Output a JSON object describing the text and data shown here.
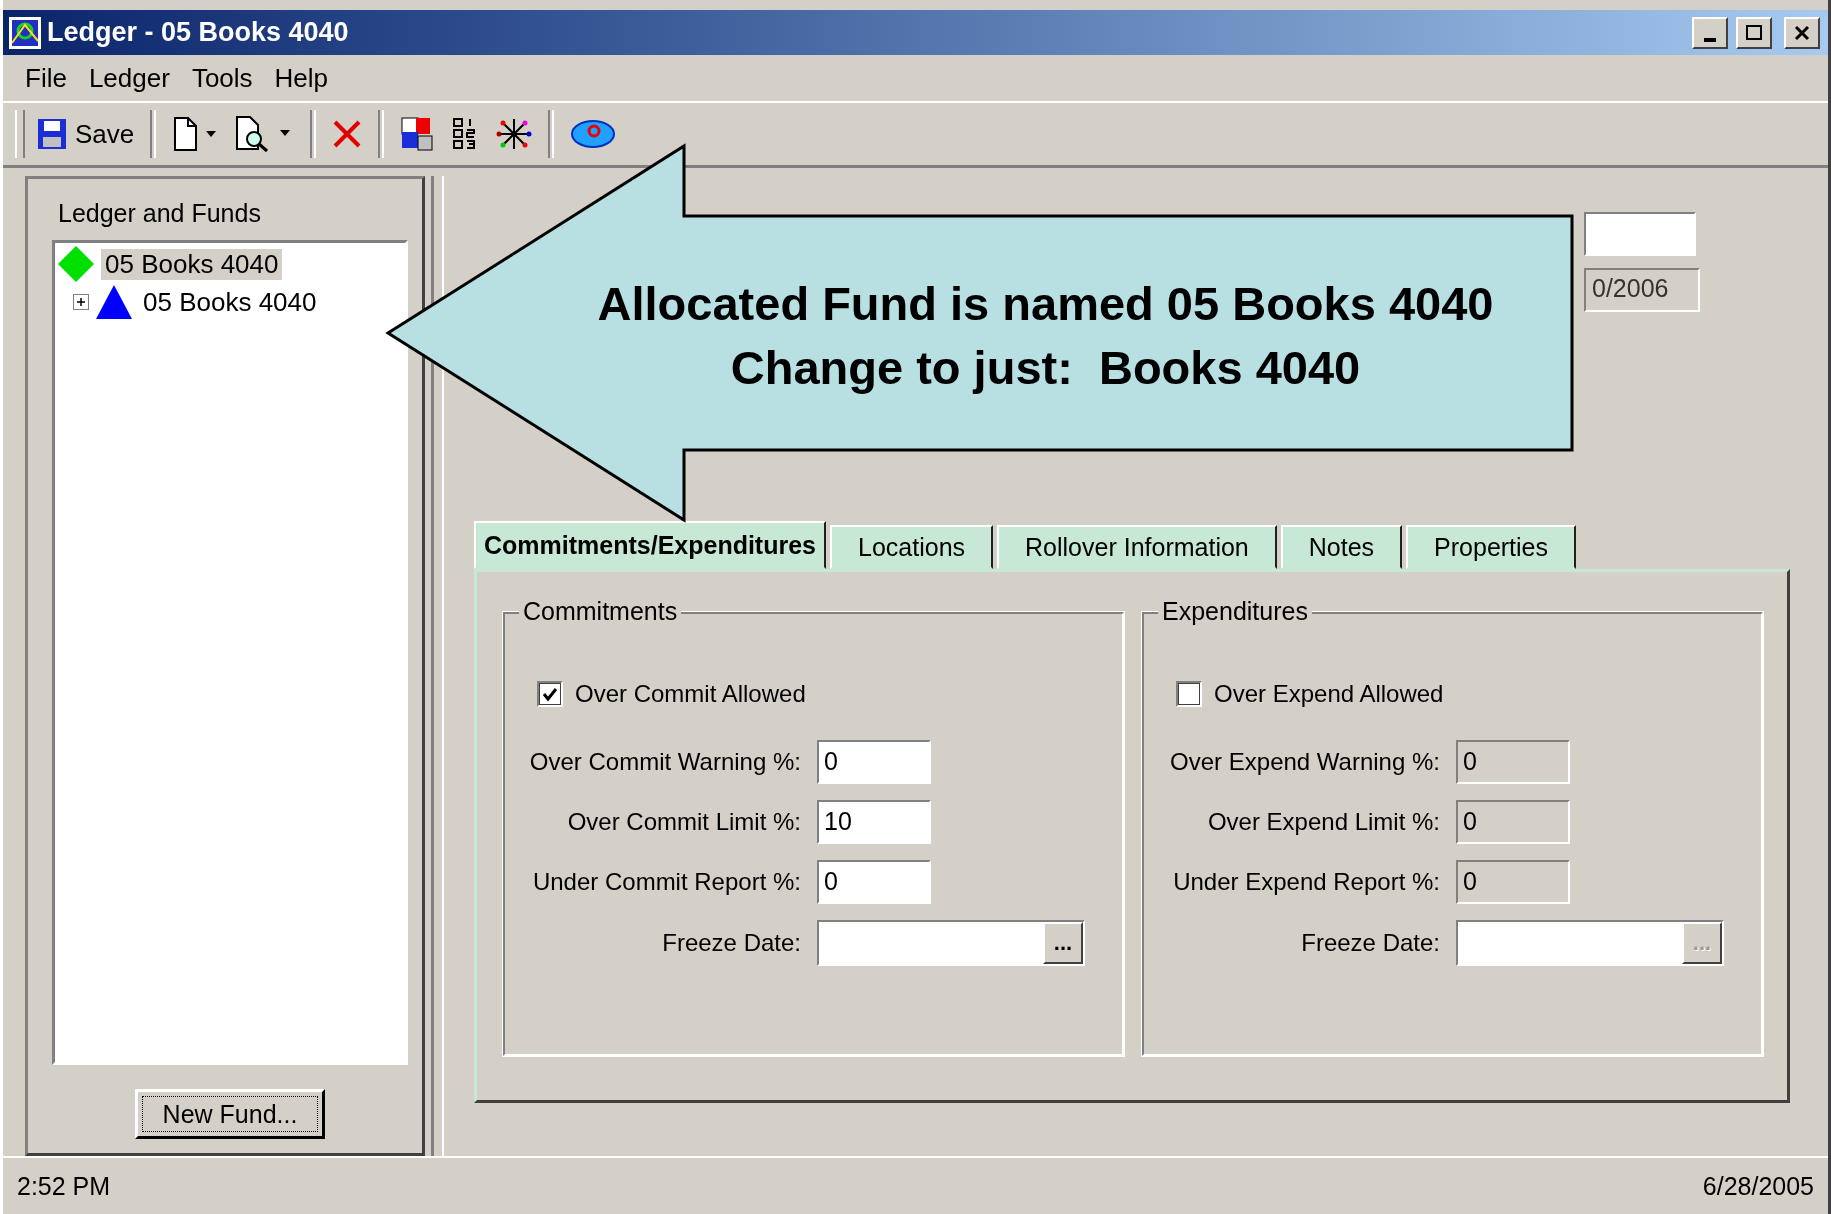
{
  "window": {
    "title": "Ledger - 05 Books 4040"
  },
  "menu": [
    {
      "label": "File"
    },
    {
      "label": "Ledger"
    },
    {
      "label": "Tools"
    },
    {
      "label": "Help"
    }
  ],
  "toolbar": {
    "save_label": "Save"
  },
  "left_panel": {
    "title": "Ledger and Funds",
    "button": "New Fund...",
    "tree": [
      {
        "label": "05 Books 4040",
        "kind": "ledger",
        "selected": true,
        "children": [
          {
            "label": "05 Books 4040",
            "kind": "fund",
            "selected": false,
            "expanded": false
          }
        ]
      }
    ]
  },
  "top_fields": [
    {
      "disabled": false
    },
    {
      "value": "0/2006",
      "disabled": true
    }
  ],
  "tabs": [
    {
      "label": "Commitments/Expenditures",
      "selected": true
    },
    {
      "label": "Locations",
      "selected": false
    },
    {
      "label": "Rollover Information",
      "selected": false
    },
    {
      "label": "Notes",
      "selected": false
    },
    {
      "label": "Properties",
      "selected": false
    }
  ],
  "groups": [
    {
      "title": "Commitments",
      "disabled": false,
      "checkbox": {
        "label": "Over Commit Allowed",
        "checked": true
      },
      "fields": [
        {
          "label": "Over Commit Warning %:",
          "value": "0"
        },
        {
          "label": "Over Commit Limit %:",
          "value": "10"
        },
        {
          "label": "Under Commit Report %:",
          "value": "0"
        }
      ],
      "freeze_date": {
        "label": "Freeze Date:",
        "button": "..."
      }
    },
    {
      "title": "Expenditures",
      "disabled": true,
      "checkbox": {
        "label": "Over Expend Allowed",
        "checked": false
      },
      "fields": [
        {
          "label": "Over Expend Warning %:",
          "value": "0"
        },
        {
          "label": "Over Expend Limit %:",
          "value": "0"
        },
        {
          "label": "Under Expend Report %:",
          "value": "0"
        }
      ],
      "freeze_date": {
        "label": "Freeze Date:",
        "button": "..."
      }
    }
  ],
  "status_bar": {
    "time": "2:52 PM",
    "date": "6/28/2005"
  },
  "callout": {
    "lines": [
      "Allocated Fund is named 05 Books 4040",
      "Change to just:  Books 4040"
    ]
  }
}
